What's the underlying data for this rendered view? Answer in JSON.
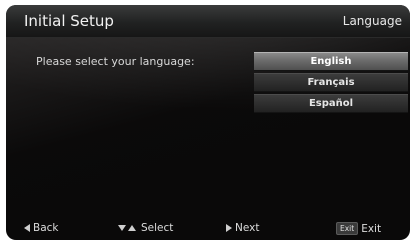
{
  "header": {
    "title": "Initial Setup",
    "section": "Language"
  },
  "main": {
    "prompt": "Please select your language:",
    "languages": [
      "English",
      "Français",
      "Español"
    ],
    "selected_index": 0
  },
  "footer": {
    "back_label": "Back",
    "select_label": "Select",
    "next_label": "Next",
    "exit_key_label": "Exit",
    "exit_label": "Exit"
  },
  "colors": {
    "background": "#0a0909",
    "highlight": "#7a7a7a",
    "text": "#e6e6e6"
  }
}
